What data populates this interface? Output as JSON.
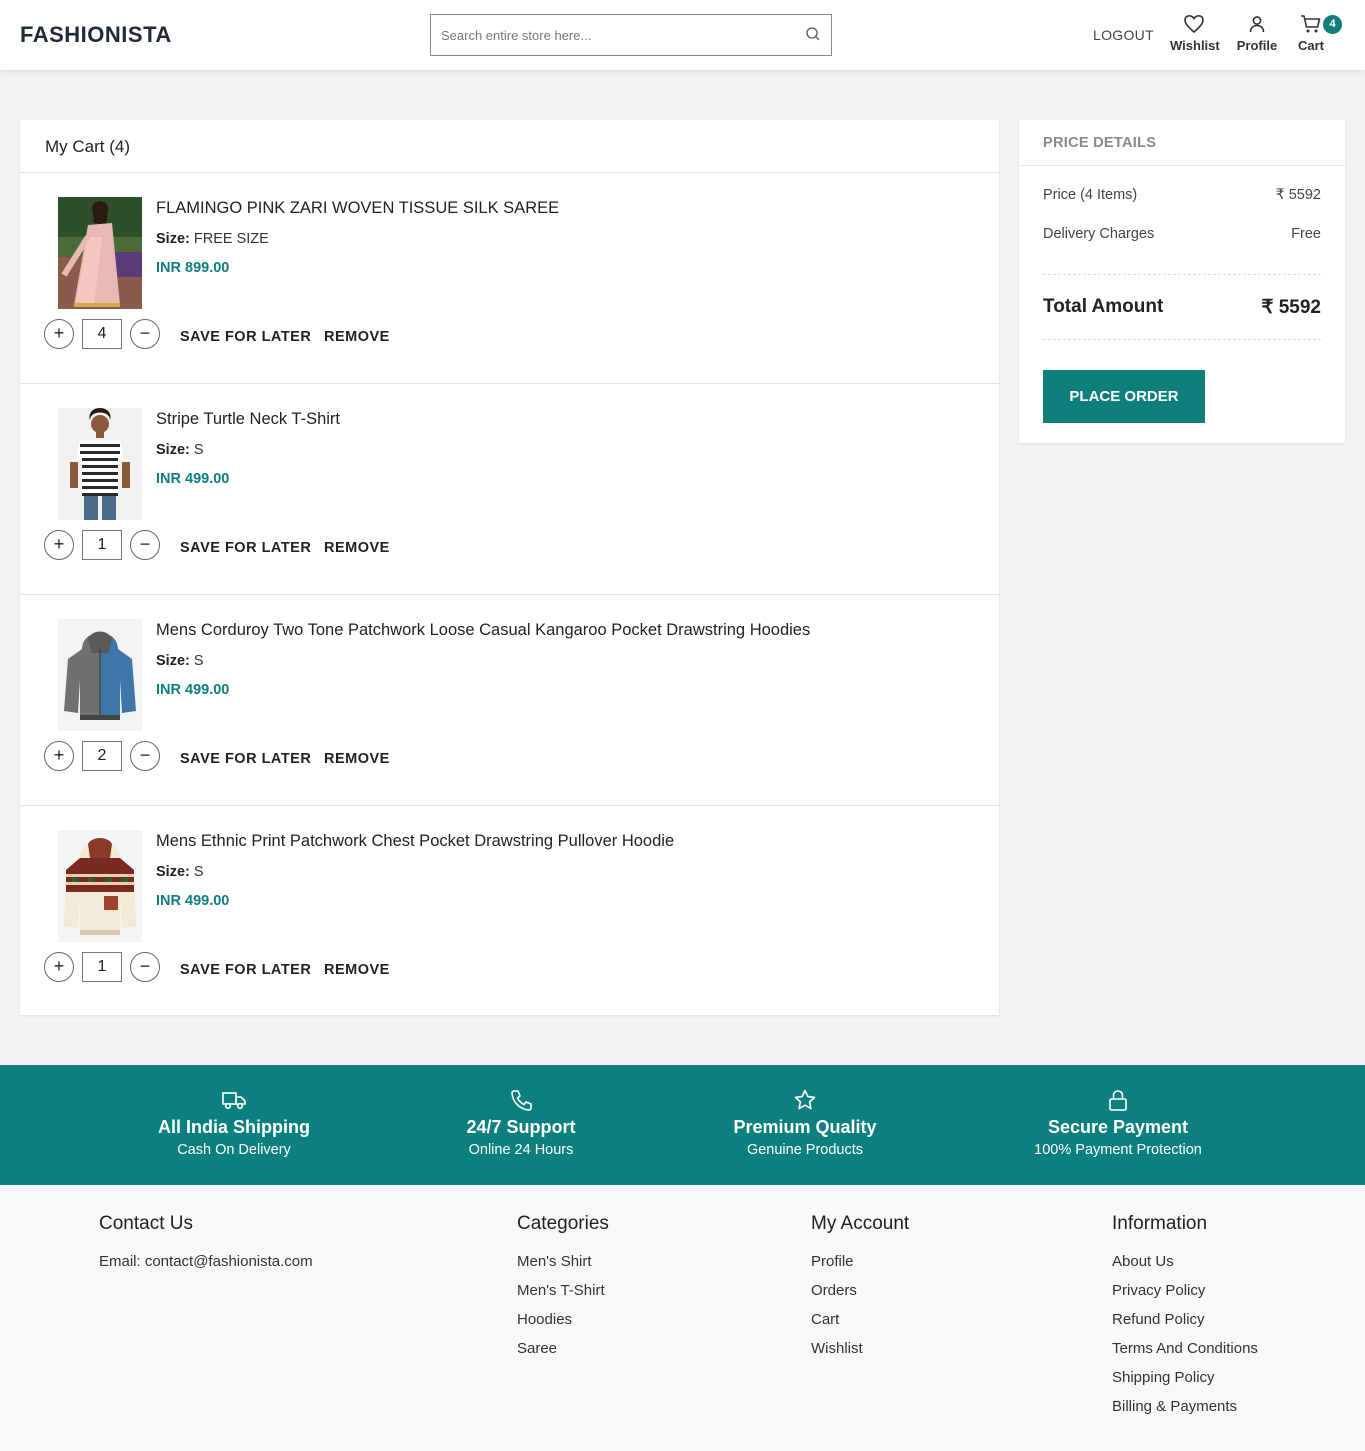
{
  "header": {
    "logo": "FASHIONISTA",
    "search_placeholder": "Search entire store here...",
    "logout": "LOGOUT",
    "wishlist": "Wishlist",
    "profile": "Profile",
    "cart": "Cart",
    "cart_count": "4"
  },
  "cart": {
    "title": "My Cart (4)",
    "size_label": "Size:",
    "save_label": "SAVE FOR LATER",
    "remove_label": "REMOVE",
    "items": [
      {
        "name": "FLAMINGO PINK ZARI WOVEN TISSUE SILK SAREE",
        "size": "FREE SIZE",
        "price": "INR 899.00",
        "qty": "4"
      },
      {
        "name": "Stripe Turtle Neck T-Shirt",
        "size": "S",
        "price": "INR 499.00",
        "qty": "1"
      },
      {
        "name": "Mens Corduroy Two Tone Patchwork Loose Casual Kangaroo Pocket Drawstring Hoodies",
        "size": "S",
        "price": "INR 499.00",
        "qty": "2"
      },
      {
        "name": "Mens Ethnic Print Patchwork Chest Pocket Drawstring Pullover Hoodie",
        "size": "S",
        "price": "INR 499.00",
        "qty": "1"
      }
    ]
  },
  "price_details": {
    "title": "PRICE DETAILS",
    "price_label": "Price (4 Items)",
    "price_value": "₹ 5592",
    "delivery_label": "Delivery Charges",
    "delivery_value": "Free",
    "total_label": "Total Amount",
    "total_value": "₹ 5592",
    "place_order": "PLACE ORDER"
  },
  "features": [
    {
      "icon": "truck-icon",
      "title": "All India Shipping",
      "sub": "Cash On Delivery"
    },
    {
      "icon": "phone-icon",
      "title": "24/7 Support",
      "sub": "Online 24 Hours"
    },
    {
      "icon": "star-icon",
      "title": "Premium Quality",
      "sub": "Genuine Products"
    },
    {
      "icon": "lock-icon",
      "title": "Secure Payment",
      "sub": "100% Payment Protection"
    }
  ],
  "footer": {
    "contact": {
      "title": "Contact Us",
      "email": "Email: contact@fashionista.com"
    },
    "categories": {
      "title": "Categories",
      "links": [
        "Men's Shirt",
        "Men's T-Shirt",
        "Hoodies",
        "Saree"
      ]
    },
    "account": {
      "title": "My Account",
      "links": [
        "Profile",
        "Orders",
        "Cart",
        "Wishlist"
      ]
    },
    "information": {
      "title": "Information",
      "links": [
        "About Us",
        "Privacy Policy",
        "Refund Policy",
        "Terms And Conditions",
        "Shipping Policy",
        "Billing & Payments"
      ]
    }
  },
  "colors": {
    "accent": "#0f7f7c",
    "band": "#0b807e",
    "price": "#117e7e"
  }
}
